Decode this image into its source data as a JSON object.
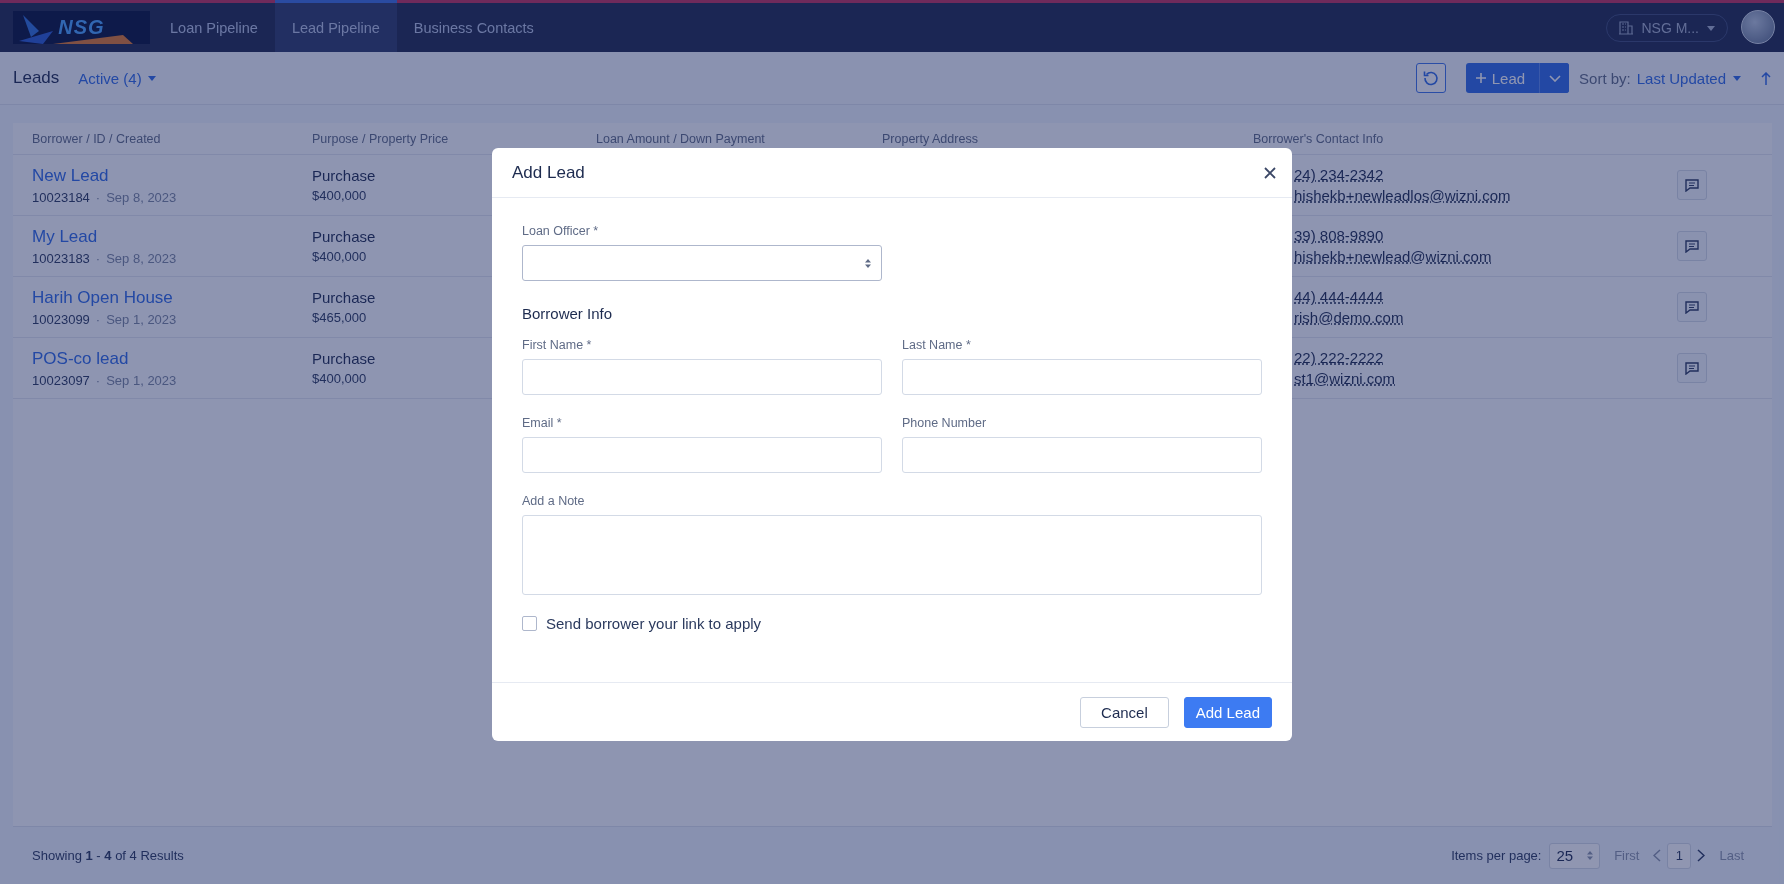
{
  "header": {
    "logo": "NSG",
    "nav": [
      {
        "label": "Loan Pipeline",
        "selected": false
      },
      {
        "label": "Lead Pipeline",
        "selected": true
      },
      {
        "label": "Business Contacts",
        "selected": false
      }
    ],
    "org_menu": "NSG M..."
  },
  "toolbar": {
    "title": "Leads",
    "filter": "Active (4)",
    "new_button": "Lead",
    "sort_label": "Sort by:",
    "sort_value": "Last Updated"
  },
  "table": {
    "columns": [
      "Borrower / ID / Created",
      "Purpose / Property Price",
      "Loan Amount / Down Payment",
      "Property Address",
      "Borrower's Contact Info"
    ],
    "rows": [
      {
        "name": "New Lead",
        "id": "10023184",
        "separator": "·",
        "created": "Sep 8, 2023",
        "purpose": "Purchase",
        "price": "$400,000",
        "phone": "24) 234-2342",
        "email": "hishekb+newleadlos@wizni.com"
      },
      {
        "name": "My Lead",
        "id": "10023183",
        "separator": "·",
        "created": "Sep 8, 2023",
        "purpose": "Purchase",
        "price": "$400,000",
        "phone": "39) 808-9890",
        "email": "hishekb+newlead@wizni.com"
      },
      {
        "name": "Harih Open House",
        "id": "10023099",
        "separator": "·",
        "created": "Sep 1, 2023",
        "purpose": "Purchase",
        "price": "$465,000",
        "phone": "44) 444-4444",
        "email": "rish@demo.com"
      },
      {
        "name": "POS-co lead",
        "id": "10023097",
        "separator": "·",
        "created": "Sep 1, 2023",
        "purpose": "Purchase",
        "price": "$400,000",
        "phone": "22) 222-2222",
        "email": "st1@wizni.com"
      }
    ]
  },
  "footer": {
    "showing": "Showing **1** - **4** of 4 Results",
    "items_label": "Items per page:",
    "items_value": "25",
    "first": "First",
    "page": "1",
    "last": "Last"
  },
  "modal": {
    "title": "Add Lead",
    "loan_officer": "Loan Officer *",
    "section_title": "Borrower Info",
    "fields": [
      {
        "label": "First Name *"
      },
      {
        "label": "Last Name *"
      },
      {
        "label": "Email *"
      },
      {
        "label": "Phone Number"
      }
    ],
    "note": "Add a Note",
    "checkbox": {
      "label": "Send borrower your link to apply",
      "checked": false
    },
    "buttons": [
      {
        "label": "Cancel",
        "kind": "secondary"
      },
      {
        "label": "Add Lead",
        "kind": "primary"
      }
    ]
  }
}
